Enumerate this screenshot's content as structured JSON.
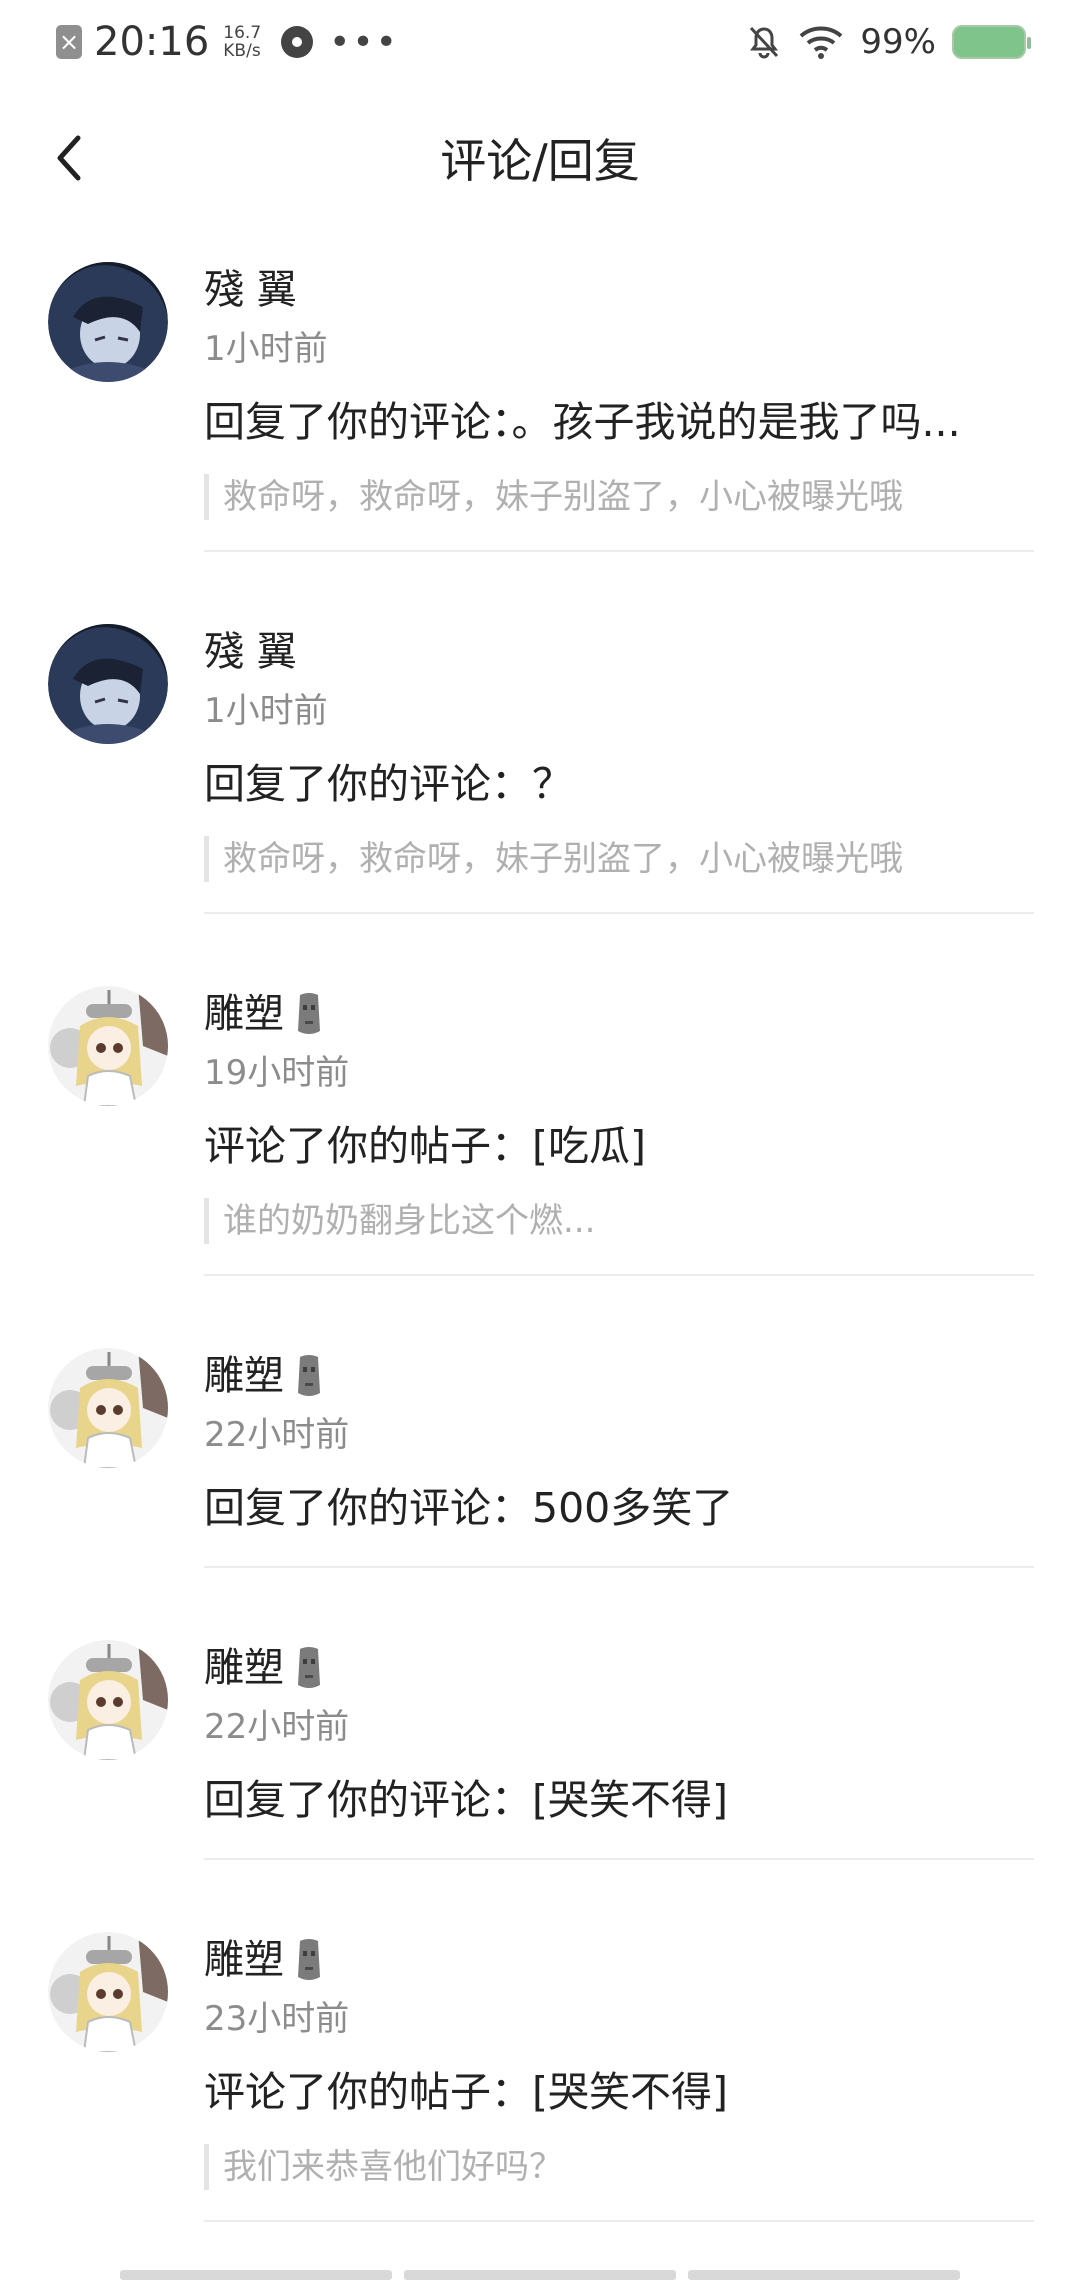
{
  "status_bar": {
    "close_glyph": "×",
    "time": "20:16",
    "net_speed_value": "16.7",
    "net_speed_unit": "KB/s",
    "more_glyph": "•••",
    "battery_percent": "99%",
    "icons": [
      "bell-off-icon",
      "wifi-icon",
      "battery-icon",
      "music-disc-icon"
    ]
  },
  "header": {
    "title": "评论/回复",
    "back_icon": "chevron-left-icon"
  },
  "notifications": [
    {
      "avatar": "anime-boy-dark",
      "user": "殘 翼",
      "has_badge": false,
      "time": "1小时前",
      "message": "回复了你的评论：。孩子我说的是我了吗...",
      "quote": "救命呀，救命呀，妹子别盗了，小心被曝光哦"
    },
    {
      "avatar": "anime-boy-dark",
      "user": "殘 翼",
      "has_badge": false,
      "time": "1小时前",
      "message": "回复了你的评论：？",
      "quote": "救命呀，救命呀，妹子别盗了，小心被曝光哦"
    },
    {
      "avatar": "anime-girl-blonde",
      "user": "雕塑",
      "has_badge": true,
      "time": "19小时前",
      "message": "评论了你的帖子：[吃瓜]",
      "quote": "谁的奶奶翻身比这个燃..."
    },
    {
      "avatar": "anime-girl-blonde",
      "user": "雕塑",
      "has_badge": true,
      "time": "22小时前",
      "message": "回复了你的评论：500多笑了",
      "quote": ""
    },
    {
      "avatar": "anime-girl-blonde",
      "user": "雕塑",
      "has_badge": true,
      "time": "22小时前",
      "message": "回复了你的评论：[哭笑不得]",
      "quote": ""
    },
    {
      "avatar": "anime-girl-blonde",
      "user": "雕塑",
      "has_badge": true,
      "time": "23小时前",
      "message": "评论了你的帖子：[哭笑不得]",
      "quote": "我们来恭喜他们好吗？"
    }
  ],
  "colors": {
    "text_primary": "#222222",
    "text_secondary": "#8c8c8c",
    "quote_text": "#b0b0b0",
    "divider": "#ececec"
  }
}
